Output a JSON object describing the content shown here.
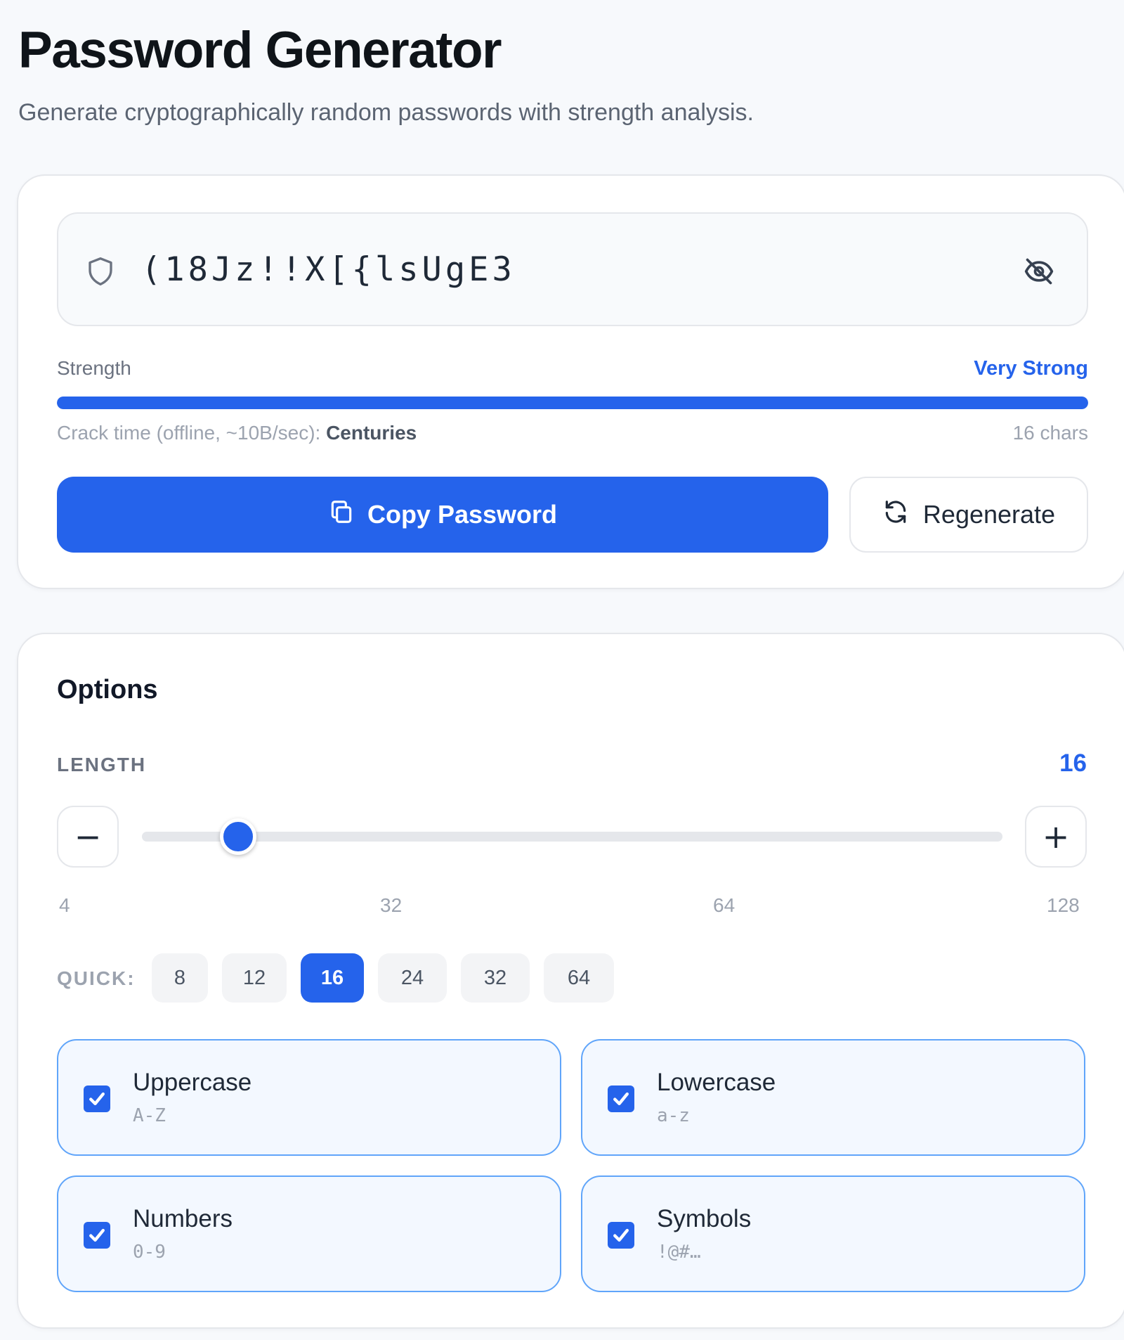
{
  "header": {
    "title": "Password Generator",
    "subtitle": "Generate cryptographically random passwords with strength analysis."
  },
  "generator": {
    "password": "(18Jz!!X[{lsUgE3",
    "shield_icon": "shield-icon",
    "visibility_icon": "eye-off-icon",
    "strength_label": "Strength",
    "strength_value": "Very Strong",
    "strength_fraction": 1.0,
    "crack_label": "Crack time (offline, ~10B/sec):",
    "crack_value": "Centuries",
    "char_count": "16 chars",
    "copy_label": "Copy Password",
    "copy_icon": "copy-icon",
    "regenerate_label": "Regenerate",
    "regenerate_icon": "refresh-icon"
  },
  "options": {
    "title": "Options",
    "length_label": "LENGTH",
    "length_value": "16",
    "length_min": 4,
    "length_max": 128,
    "decrement_symbol": "−",
    "increment_symbol": "+",
    "ticks": [
      "4",
      "32",
      "64",
      "128"
    ],
    "quick_label": "QUICK:",
    "quick_presets": [
      "8",
      "12",
      "16",
      "24",
      "32",
      "64"
    ],
    "quick_selected": "16",
    "charsets": [
      {
        "name": "Uppercase",
        "range": "A-Z",
        "checked": true
      },
      {
        "name": "Lowercase",
        "range": "a-z",
        "checked": true
      },
      {
        "name": "Numbers",
        "range": "0-9",
        "checked": true
      },
      {
        "name": "Symbols",
        "range": "!@#…",
        "checked": true
      }
    ]
  },
  "colors": {
    "accent": "#2563eb",
    "card_border": "#e5e7eb",
    "charset_border": "#60a5fa",
    "background": "#f7f9fc"
  }
}
